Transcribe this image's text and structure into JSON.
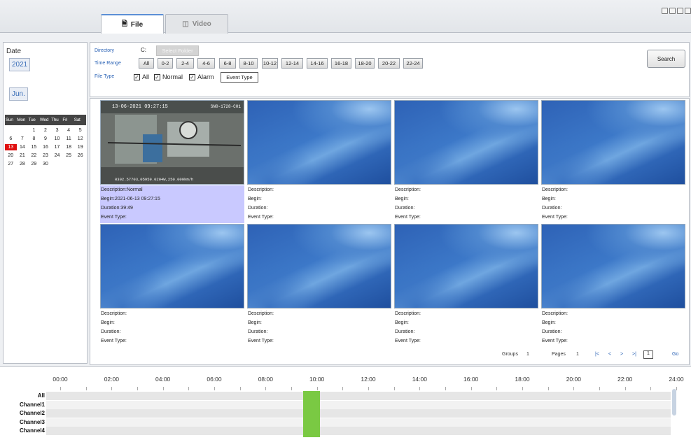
{
  "tabs": [
    {
      "label": "File",
      "icon": "file-icon",
      "active": true
    },
    {
      "label": "Video",
      "icon": "video-icon",
      "active": false
    }
  ],
  "left": {
    "date_label": "Date",
    "year": "2021",
    "month": "Jun.",
    "weekdays": [
      "Sun",
      "Mon",
      "Tue",
      "Wed",
      "Thu",
      "Fri",
      "Sat"
    ],
    "days": [
      "",
      "",
      "1",
      "2",
      "3",
      "4",
      "5",
      "6",
      "7",
      "8",
      "9",
      "10",
      "11",
      "12",
      "13",
      "14",
      "15",
      "16",
      "17",
      "18",
      "19",
      "20",
      "21",
      "22",
      "23",
      "24",
      "25",
      "26",
      "27",
      "28",
      "29",
      "30"
    ],
    "selected_day": "13"
  },
  "filter": {
    "directory_label": "Directory",
    "directory_value": "C:",
    "select_folder": "Select Folder",
    "time_range_label": "Time Range",
    "time_ranges": [
      "All",
      "0-2",
      "2-4",
      "4-6",
      "6-8",
      "8-10",
      "10-12",
      "12-14",
      "14-16",
      "16-18",
      "18-20",
      "20-22",
      "22-24"
    ],
    "file_type_label": "File Type",
    "types": [
      {
        "label": "All",
        "checked": true
      },
      {
        "label": "Normal",
        "checked": true
      },
      {
        "label": "Alarm",
        "checked": true
      }
    ],
    "event_type_button": "Event Type",
    "search": "Search"
  },
  "files": [
    {
      "description": "Description:Normal",
      "begin": "Begin:2021-06-13 09:27:15",
      "duration": "Duration:39:49",
      "event_type": "Event Type:",
      "thumb": "camera",
      "overlay_top_left": "13-06-2021 09:27:15",
      "overlay_top_right": "SN0-1728-C01",
      "overlay_bottom": "0302.57703,05959.0204W,250.000km/h",
      "selected": true
    },
    {
      "description": "Description:",
      "begin": "Begin:",
      "duration": "Duration:",
      "event_type": "Event Type:",
      "thumb": "wallpaper"
    },
    {
      "description": "Description:",
      "begin": "Begin:",
      "duration": "Duration:",
      "event_type": "Event Type:",
      "thumb": "wallpaper"
    },
    {
      "description": "Description:",
      "begin": "Begin:",
      "duration": "Duration:",
      "event_type": "Event Type:",
      "thumb": "wallpaper"
    },
    {
      "description": "Description:",
      "begin": "Begin:",
      "duration": "Duration:",
      "event_type": "Event Type:",
      "thumb": "wallpaper"
    },
    {
      "description": "Description:",
      "begin": "Begin:",
      "duration": "Duration:",
      "event_type": "Event Type:",
      "thumb": "wallpaper"
    },
    {
      "description": "Description:",
      "begin": "Begin:",
      "duration": "Duration:",
      "event_type": "Event Type:",
      "thumb": "wallpaper"
    },
    {
      "description": "Description:",
      "begin": "Begin:",
      "duration": "Duration:",
      "event_type": "Event Type:",
      "thumb": "wallpaper"
    }
  ],
  "paging": {
    "groups_label": "Groups",
    "groups": "1",
    "pages_label": "Pages",
    "pages": "1",
    "first": "|<",
    "prev": "<",
    "next": ">",
    "last": ">|",
    "page_input": "1",
    "go": "Go"
  },
  "timeline": {
    "ticks": [
      "00:00",
      "02:00",
      "04:00",
      "06:00",
      "08:00",
      "10:00",
      "12:00",
      "14:00",
      "16:00",
      "18:00",
      "20:00",
      "22:00",
      "24:00"
    ],
    "channels": [
      "All",
      "Channel1",
      "Channel2",
      "Channel3",
      "Channel4"
    ],
    "recording": {
      "start": "09:27",
      "end": "10:07",
      "color": "#7ac943"
    }
  }
}
